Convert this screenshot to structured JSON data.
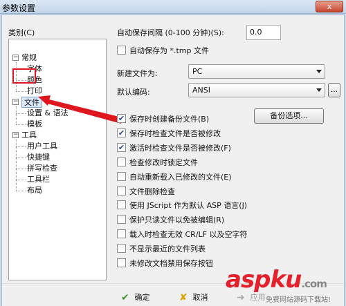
{
  "window": {
    "title": "参数设置",
    "close_label": "x"
  },
  "tree": {
    "category_label": "类别(C)",
    "items": [
      {
        "label": "常规",
        "level": 0,
        "expander": "−"
      },
      {
        "label": "字体",
        "level": 1
      },
      {
        "label": "颜色",
        "level": 1
      },
      {
        "label": "打印",
        "level": 1
      },
      {
        "label": "文件",
        "level": 0,
        "expander": "−",
        "selected": true
      },
      {
        "label": "设置 & 语法",
        "level": 1
      },
      {
        "label": "模板",
        "level": 1
      },
      {
        "label": "工具",
        "level": 0,
        "expander": "−"
      },
      {
        "label": "用户工具",
        "level": 1
      },
      {
        "label": "快捷键",
        "level": 1
      },
      {
        "label": "拼写检查",
        "level": 1
      },
      {
        "label": "工具栏",
        "level": 1
      },
      {
        "label": "布局",
        "level": 1
      }
    ]
  },
  "settings": {
    "autosave_interval_label": "自动保存间隔 (0-100 分钟)(S):",
    "autosave_interval_value": "0.0",
    "autosave_tmp_label": "自动保存为 *.tmp 文件",
    "autosave_tmp_checked": false,
    "new_file_label": "新建文件为:",
    "new_file_value": "PC",
    "default_encoding_label": "默认编码:",
    "default_encoding_value": "ANSI",
    "ellipsis_label": "...",
    "backup_button_label": "备份选项..."
  },
  "checkboxes": [
    {
      "label": "保存时创建备份文件(B)",
      "checked": true
    },
    {
      "label": "保存时检查文件是否被修改",
      "checked": true
    },
    {
      "label": "激活时检查文件是否被修改(F)",
      "checked": true
    },
    {
      "label": "检查修改时锁定文件",
      "checked": false
    },
    {
      "label": "自动重新载入已修改的文件(E)",
      "checked": false
    },
    {
      "label": "文件删除检查",
      "checked": false
    },
    {
      "label": "使用 JScript 作为默认 ASP 语言(J)",
      "checked": false
    },
    {
      "label": "保护只读文件以免被编辑(R)",
      "checked": false
    },
    {
      "label": "载入时检查无效 CR/LF 以及空字符",
      "checked": false
    },
    {
      "label": "不显示最近的文件列表",
      "checked": false
    },
    {
      "label": "未修改文档禁用保存按钮",
      "checked": false
    }
  ],
  "footer": {
    "ok_label": "确定",
    "cancel_label": "取消",
    "apply_label": "应用"
  },
  "watermark": {
    "brand": "aspku",
    "tld": ".com",
    "tagline": "免费网站源码下载站!"
  },
  "colors": {
    "highlight_red": "#e0161f",
    "watermark_red": "#e4202b"
  }
}
